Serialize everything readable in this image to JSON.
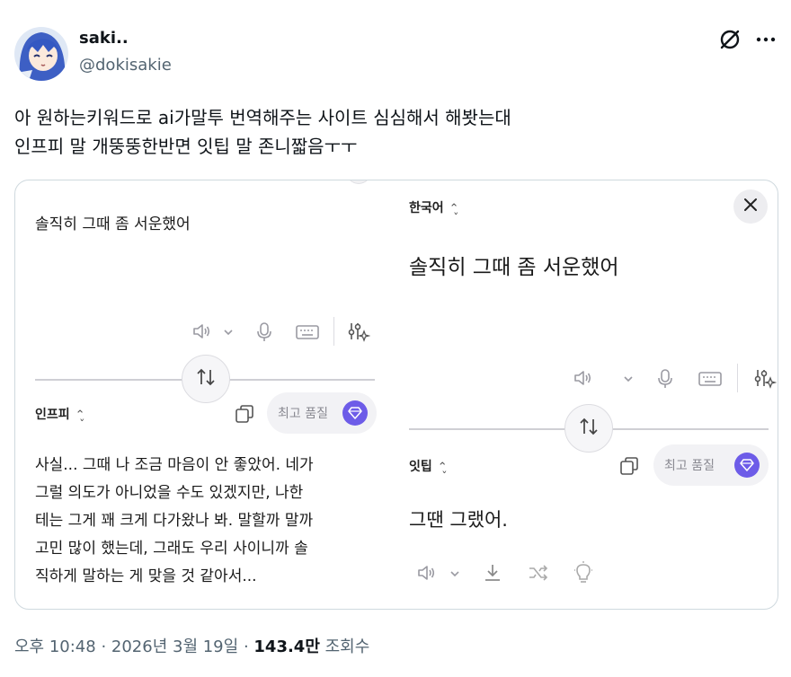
{
  "author": {
    "name": "saki..",
    "handle": "@dokisakie"
  },
  "tweet": {
    "line1": "아 원하는키워드로 ai가말투 번역해주는 사이트 심심해서 해봣는대",
    "line2": "인프피 말 개뚱뚱한반면 잇팁 말 존니짧음ㅜㅜ"
  },
  "translator": {
    "left": {
      "source_text": "솔직히 그때 좀 서운했어",
      "target_lang": "인프피",
      "quality_label": "최고 품질",
      "output_lines": [
        "사실... 그때 나 조금 마음이 안 좋았어. 네가",
        "그럴 의도가 아니었을 수도 있겠지만, 나한",
        "테는 그게 꽤 크게 다가왔나 봐. 말할까 말까",
        "고민 많이 했는데, 그래도 우리 사이니까 솔",
        "직하게 말하는 게 맞을 것 같아서..."
      ]
    },
    "right": {
      "source_lang": "한국어",
      "source_text": "솔직히 그때 좀 서운했어",
      "target_lang": "잇팁",
      "quality_label": "최고 품질",
      "output_text": "그땐 그랬어."
    }
  },
  "footer": {
    "time": "오후 10:48",
    "date": "2026년 3월 19일",
    "views_count": "143.4만",
    "views_label": "조회수"
  },
  "colors": {
    "accent_purple": "#6d5ce8",
    "muted_text": "#536471"
  },
  "icons": [
    "grok-icon",
    "more-icon",
    "speaker-icon",
    "microphone-icon",
    "keyboard-icon",
    "settings-sparkle-icon",
    "swap-icon",
    "copy-icon",
    "gem-icon",
    "close-icon",
    "download-icon",
    "shuffle-icon",
    "lightbulb-icon"
  ]
}
